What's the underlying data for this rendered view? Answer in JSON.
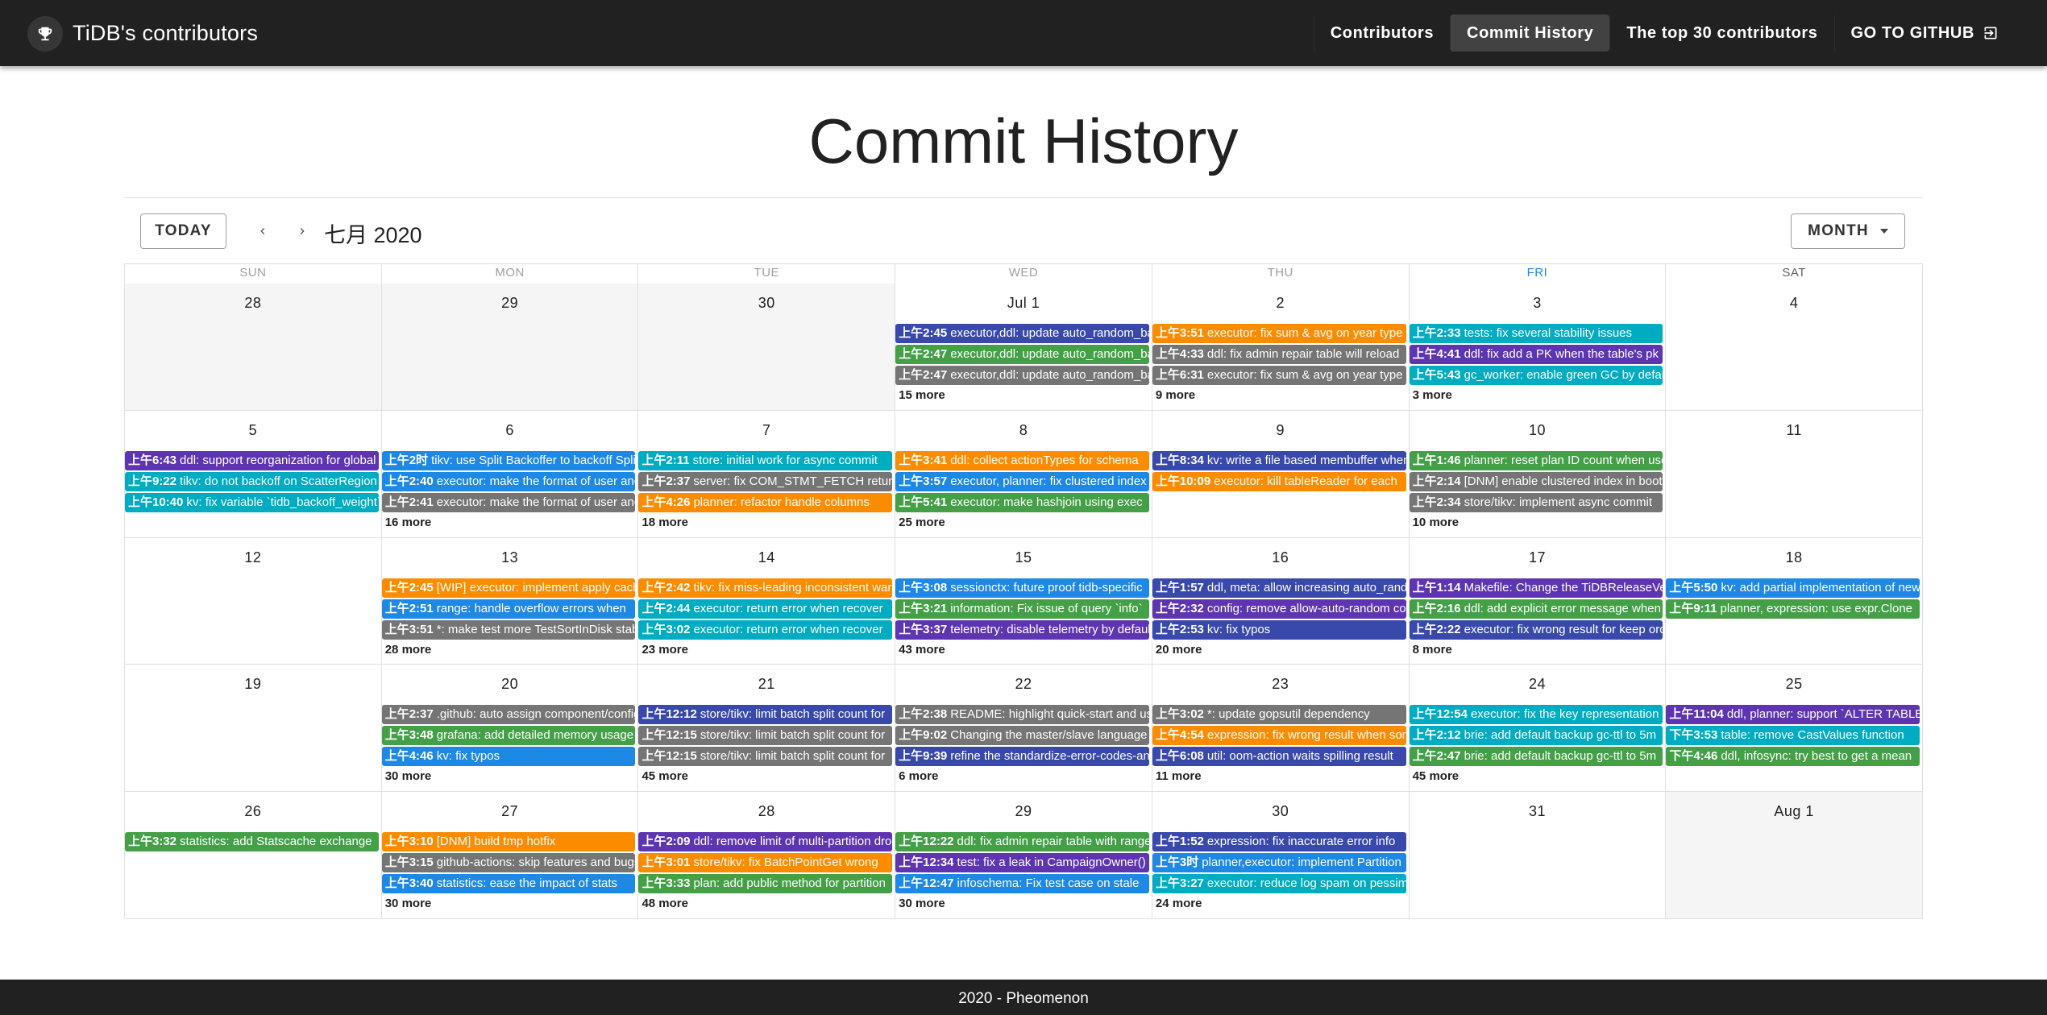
{
  "app": {
    "title": "TiDB's contributors",
    "logo_icon": "trophy-icon"
  },
  "nav": [
    {
      "label": "Contributors",
      "active": false
    },
    {
      "label": "Commit History",
      "active": true
    },
    {
      "label": "The top 30 contributors",
      "active": false
    },
    {
      "label": "GO TO GITHUB",
      "active": false,
      "icon": "open-external-icon"
    }
  ],
  "page": {
    "title": "Commit History"
  },
  "toolbar": {
    "today_label": "TODAY",
    "month_label": "七月 2020",
    "view_label": "MONTH",
    "prev_icon": "chevron-left-icon",
    "next_icon": "chevron-right-icon"
  },
  "colors": {
    "indigo": "#3949ab",
    "green": "#43a047",
    "grey": "#757575",
    "orange": "#fb8c00",
    "cyan": "#00acc1",
    "deep-purple": "#5e35b1",
    "blue": "#1e88e5",
    "appbar": "#212121"
  },
  "calendar": {
    "weekdays": [
      "SUN",
      "MON",
      "TUE",
      "WED",
      "THU",
      "FRI",
      "SAT"
    ],
    "weeks": [
      [
        {
          "label": "28",
          "outside": true,
          "events": [],
          "more": ""
        },
        {
          "label": "29",
          "outside": true,
          "events": [],
          "more": ""
        },
        {
          "label": "30",
          "outside": true,
          "events": [],
          "more": ""
        },
        {
          "label": "Jul 1",
          "outside": false,
          "events": [
            {
              "time": "上午2:45",
              "title": "executor,ddl: update auto_random_base",
              "color": "indigo"
            },
            {
              "time": "上午2:47",
              "title": "executor,ddl: update auto_random_base",
              "color": "green"
            },
            {
              "time": "上午2:47",
              "title": "executor,ddl: update auto_random_base",
              "color": "grey"
            }
          ],
          "more": "15 more"
        },
        {
          "label": "2",
          "outside": false,
          "events": [
            {
              "time": "上午3:51",
              "title": "executor: fix sum & avg on year type",
              "color": "orange"
            },
            {
              "time": "上午4:33",
              "title": "ddl: fix admin repair table will reload",
              "color": "grey"
            },
            {
              "time": "上午6:31",
              "title": "executor: fix sum & avg on year type",
              "color": "grey"
            }
          ],
          "more": "9 more"
        },
        {
          "label": "3",
          "outside": false,
          "events": [
            {
              "time": "上午2:33",
              "title": "tests: fix several stability issues",
              "color": "cyan"
            },
            {
              "time": "上午4:41",
              "title": "ddl: fix add a PK when the table's pk",
              "color": "deep-purple"
            },
            {
              "time": "上午5:43",
              "title": "gc_worker: enable green GC by default",
              "color": "cyan"
            }
          ],
          "more": "3 more"
        },
        {
          "label": "4",
          "outside": false,
          "events": [],
          "more": ""
        }
      ],
      [
        {
          "label": "5",
          "outside": false,
          "events": [
            {
              "time": "上午6:43",
              "title": "ddl: support reorganization for global",
              "color": "deep-purple"
            },
            {
              "time": "上午9:22",
              "title": "tikv: do not backoff on ScatterRegion",
              "color": "cyan"
            },
            {
              "time": "上午10:40",
              "title": "kv: fix variable `tidb_backoff_weight`",
              "color": "cyan"
            }
          ],
          "more": ""
        },
        {
          "label": "6",
          "outside": false,
          "events": [
            {
              "time": "上午2时",
              "title": "tikv: use Split Backoffer to backoff Split",
              "color": "blue"
            },
            {
              "time": "上午2:40",
              "title": "executor: make the format of user and",
              "color": "blue"
            },
            {
              "time": "上午2:41",
              "title": "executor: make the format of user and",
              "color": "grey"
            }
          ],
          "more": "16 more"
        },
        {
          "label": "7",
          "outside": false,
          "events": [
            {
              "time": "上午2:11",
              "title": "store: initial work for async commit",
              "color": "cyan"
            },
            {
              "time": "上午2:37",
              "title": "server: fix COM_STMT_FETCH return",
              "color": "grey"
            },
            {
              "time": "上午4:26",
              "title": "planner: refactor handle columns",
              "color": "orange"
            }
          ],
          "more": "18 more"
        },
        {
          "label": "8",
          "outside": false,
          "events": [
            {
              "time": "上午3:41",
              "title": "ddl: collect actionTypes for schema",
              "color": "orange"
            },
            {
              "time": "上午3:57",
              "title": "executor, planner: fix clustered index",
              "color": "blue"
            },
            {
              "time": "上午5:41",
              "title": "executor: make hashjoin using exec",
              "color": "green"
            }
          ],
          "more": "25 more"
        },
        {
          "label": "9",
          "outside": false,
          "events": [
            {
              "time": "上午8:34",
              "title": "kv: write a file based membuffer when",
              "color": "indigo"
            },
            {
              "time": "上午10:09",
              "title": "executor: kill tableReader for each",
              "color": "orange"
            }
          ],
          "more": ""
        },
        {
          "label": "10",
          "outside": false,
          "events": [
            {
              "time": "上午1:46",
              "title": "planner: reset plan ID count when use",
              "color": "green"
            },
            {
              "time": "上午2:14",
              "title": "[DNM] enable clustered index in bootstrap",
              "color": "grey"
            },
            {
              "time": "上午2:34",
              "title": "store/tikv: implement async commit",
              "color": "grey"
            }
          ],
          "more": "10 more"
        },
        {
          "label": "11",
          "outside": false,
          "events": [],
          "more": ""
        }
      ],
      [
        {
          "label": "12",
          "outside": false,
          "events": [],
          "more": ""
        },
        {
          "label": "13",
          "outside": false,
          "events": [
            {
              "time": "上午2:45",
              "title": "[WIP] executor: implement apply cache",
              "color": "orange"
            },
            {
              "time": "上午2:51",
              "title": "range: handle overflow errors when",
              "color": "blue"
            },
            {
              "time": "上午3:51",
              "title": "*: make test more TestSortInDisk stable",
              "color": "grey"
            }
          ],
          "more": "28 more"
        },
        {
          "label": "14",
          "outside": false,
          "events": [
            {
              "time": "上午2:42",
              "title": "tikv: fix miss-leading inconsistent warn",
              "color": "orange"
            },
            {
              "time": "上午2:44",
              "title": "executor: return error when recover",
              "color": "cyan"
            },
            {
              "time": "上午3:02",
              "title": "executor: return error when recover",
              "color": "cyan"
            }
          ],
          "more": "23 more"
        },
        {
          "label": "15",
          "outside": false,
          "events": [
            {
              "time": "上午3:08",
              "title": "sessionctx: future proof tidb-specific",
              "color": "blue"
            },
            {
              "time": "上午3:21",
              "title": "information: Fix issue of query `info`",
              "color": "green"
            },
            {
              "time": "上午3:37",
              "title": "telemetry: disable telemetry by default",
              "color": "deep-purple"
            }
          ],
          "more": "43 more"
        },
        {
          "label": "16",
          "outside": false,
          "events": [
            {
              "time": "上午1:57",
              "title": "ddl, meta: allow increasing auto_random",
              "color": "indigo"
            },
            {
              "time": "上午2:32",
              "title": "config: remove allow-auto-random config",
              "color": "deep-purple"
            },
            {
              "time": "上午2:53",
              "title": "kv: fix typos",
              "color": "indigo"
            }
          ],
          "more": "20 more"
        },
        {
          "label": "17",
          "outside": false,
          "events": [
            {
              "time": "上午1:14",
              "title": "Makefile: Change the TiDBReleaseVersion",
              "color": "deep-purple"
            },
            {
              "time": "上午2:16",
              "title": "ddl: add explicit error message when",
              "color": "green"
            },
            {
              "time": "上午2:22",
              "title": "executor: fix wrong result for keep order",
              "color": "indigo"
            }
          ],
          "more": "8 more"
        },
        {
          "label": "18",
          "outside": false,
          "events": [
            {
              "time": "上午5:50",
              "title": "kv: add partial implementation of new",
              "color": "blue"
            },
            {
              "time": "上午9:11",
              "title": "planner, expression: use expr.Clone",
              "color": "green"
            }
          ],
          "more": ""
        }
      ],
      [
        {
          "label": "19",
          "outside": false,
          "events": [],
          "more": ""
        },
        {
          "label": "20",
          "outside": false,
          "events": [
            {
              "time": "上午2:37",
              "title": ".github: auto assign component/config",
              "color": "grey"
            },
            {
              "time": "上午3:48",
              "title": "grafana: add detailed memory usage",
              "color": "green"
            },
            {
              "time": "上午4:46",
              "title": "kv: fix typos",
              "color": "blue"
            }
          ],
          "more": "30 more"
        },
        {
          "label": "21",
          "outside": false,
          "events": [
            {
              "time": "上午12:12",
              "title": "store/tikv: limit batch split count for",
              "color": "indigo"
            },
            {
              "time": "上午12:15",
              "title": "store/tikv: limit batch split count for",
              "color": "grey"
            },
            {
              "time": "上午12:15",
              "title": "store/tikv: limit batch split count for",
              "color": "grey"
            }
          ],
          "more": "45 more"
        },
        {
          "label": "22",
          "outside": false,
          "events": [
            {
              "time": "上午2:38",
              "title": "README: highlight quick-start and user",
              "color": "grey"
            },
            {
              "time": "上午9:02",
              "title": "Changing the master/slave language",
              "color": "grey"
            },
            {
              "time": "上午9:39",
              "title": "refine the standardize-error-codes-and",
              "color": "indigo"
            }
          ],
          "more": "6 more"
        },
        {
          "label": "23",
          "outside": false,
          "events": [
            {
              "time": "上午3:02",
              "title": "*: update gopsutil dependency",
              "color": "grey"
            },
            {
              "time": "上午4:54",
              "title": "expression: fix wrong result when sort",
              "color": "orange"
            },
            {
              "time": "上午6:08",
              "title": "util: oom-action waits spilling result",
              "color": "indigo"
            }
          ],
          "more": "11 more"
        },
        {
          "label": "24",
          "outside": false,
          "events": [
            {
              "time": "上午12:54",
              "title": "executor: fix the key representation",
              "color": "cyan"
            },
            {
              "time": "上午2:12",
              "title": "brie: add default backup gc-ttl to 5m",
              "color": "cyan"
            },
            {
              "time": "上午2:47",
              "title": "brie: add default backup gc-ttl to 5m",
              "color": "green"
            }
          ],
          "more": "45 more"
        },
        {
          "label": "25",
          "outside": false,
          "events": [
            {
              "time": "上午11:04",
              "title": "ddl, planner: support `ALTER TABLE",
              "color": "deep-purple"
            },
            {
              "time": "下午3:53",
              "title": "table: remove CastValues function",
              "color": "cyan"
            },
            {
              "time": "下午4:46",
              "title": "ddl, infosync: try best to get a mean",
              "color": "green"
            }
          ],
          "more": ""
        }
      ],
      [
        {
          "label": "26",
          "outside": false,
          "events": [
            {
              "time": "上午3:32",
              "title": "statistics: add Statscache exchange",
              "color": "green"
            }
          ],
          "more": ""
        },
        {
          "label": "27",
          "outside": false,
          "events": [
            {
              "time": "上午3:10",
              "title": "[DNM] build tmp hotfix",
              "color": "orange"
            },
            {
              "time": "上午3:15",
              "title": "github-actions: skip features and bugs",
              "color": "grey"
            },
            {
              "time": "上午3:40",
              "title": "statistics: ease the impact of stats",
              "color": "blue"
            }
          ],
          "more": "30 more"
        },
        {
          "label": "28",
          "outside": false,
          "events": [
            {
              "time": "上午2:09",
              "title": "ddl: remove limit of multi-partition drop",
              "color": "deep-purple"
            },
            {
              "time": "上午3:01",
              "title": "store/tikv: fix BatchPointGet wrong",
              "color": "orange"
            },
            {
              "time": "上午3:33",
              "title": "plan: add public method for partition",
              "color": "green"
            }
          ],
          "more": "48 more"
        },
        {
          "label": "29",
          "outside": false,
          "events": [
            {
              "time": "上午12:22",
              "title": "ddl: fix admin repair table with range",
              "color": "green"
            },
            {
              "time": "上午12:34",
              "title": "test: fix a leak in CampaignOwner()",
              "color": "deep-purple"
            },
            {
              "time": "上午12:47",
              "title": "infoschema: Fix test case on stale",
              "color": "blue"
            }
          ],
          "more": "30 more"
        },
        {
          "label": "30",
          "outside": false,
          "events": [
            {
              "time": "上午1:52",
              "title": "expression: fix inaccurate error info",
              "color": "indigo"
            },
            {
              "time": "上午3时",
              "title": "planner,executor: implement Partition",
              "color": "blue"
            },
            {
              "time": "上午3:27",
              "title": "executor: reduce log spam on pessimistic",
              "color": "cyan"
            }
          ],
          "more": "24 more"
        },
        {
          "label": "31",
          "outside": false,
          "events": [],
          "more": ""
        },
        {
          "label": "Aug 1",
          "outside": true,
          "events": [],
          "more": ""
        }
      ]
    ]
  },
  "footer": {
    "text": "2020 - Pheomenon"
  }
}
